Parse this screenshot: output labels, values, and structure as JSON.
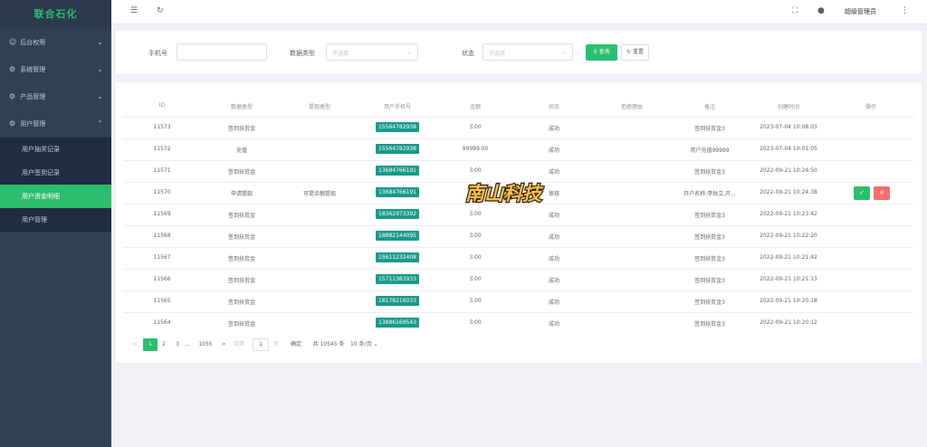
{
  "app": {
    "title": "联合石化"
  },
  "sidebar": {
    "items": [
      {
        "label": "后台权限",
        "icon": "user-icon"
      },
      {
        "label": "系统管理",
        "icon": "gear-icon"
      },
      {
        "label": "产品管理",
        "icon": "gear-icon"
      },
      {
        "label": "用户管理",
        "icon": "gear-icon"
      }
    ],
    "submenu": [
      {
        "label": "用户抽奖记录"
      },
      {
        "label": "用户签到记录"
      },
      {
        "label": "用户资金明细",
        "active": true
      },
      {
        "label": "用户管理"
      }
    ]
  },
  "topbar": {
    "user": "超级管理员"
  },
  "search": {
    "phone_label": "手机号",
    "type_label": "数据类型",
    "type_placeholder": "不选择",
    "status_label": "状态",
    "status_placeholder": "不选择",
    "search_button": "查询",
    "reset_button": "重置"
  },
  "table": {
    "headers": [
      "ID",
      "数据类型",
      "提现类型",
      "用户手机号",
      "金额",
      "状态",
      "拒绝理由",
      "备注",
      "创建时间",
      "操作"
    ],
    "rows": [
      {
        "id": "11573",
        "type": "签到扶贫金",
        "withdraw": "",
        "phone": "15564782938",
        "amount": "3.00",
        "status": "成功",
        "reason": "",
        "remark": "签到扶贫金3",
        "time": "2023-07-04 10:08:03"
      },
      {
        "id": "11572",
        "type": "充值",
        "withdraw": "",
        "phone": "15564782938",
        "amount": "99999.00",
        "status": "成功",
        "reason": "",
        "remark": "用户充值99999",
        "time": "2023-07-04 10:01:05"
      },
      {
        "id": "11571",
        "type": "签到扶贫金",
        "withdraw": "",
        "phone": "13684766191",
        "amount": "3.00",
        "status": "成功",
        "reason": "",
        "remark": "签到扶贫金3",
        "time": "2022-09-21 10:24:50"
      },
      {
        "id": "11570",
        "type": "申请提款",
        "withdraw": "可提余额提现",
        "phone": "13684766191",
        "amount": "",
        "status": "审核",
        "reason": "",
        "remark": "开户名称:李秋立,开...",
        "time": "2022-09-21 10:24:38",
        "actions": true
      },
      {
        "id": "11569",
        "type": "签到扶贫金",
        "withdraw": "",
        "phone": "18362973392",
        "amount": "3.00",
        "status": "成功",
        "reason": "",
        "remark": "签到扶贫金3",
        "time": "2022-09-21 10:23:42"
      },
      {
        "id": "11568",
        "type": "签到扶贫金",
        "withdraw": "",
        "phone": "18882144095",
        "amount": "3.00",
        "status": "成功",
        "reason": "",
        "remark": "签到扶贫金3",
        "time": "2022-09-21 10:22:20"
      },
      {
        "id": "11567",
        "type": "签到扶贫金",
        "withdraw": "",
        "phone": "15611232408",
        "amount": "3.00",
        "status": "成功",
        "reason": "",
        "remark": "签到扶贫金3",
        "time": "2022-09-21 10:21:42"
      },
      {
        "id": "11566",
        "type": "签到扶贫金",
        "withdraw": "",
        "phone": "15711383933",
        "amount": "3.00",
        "status": "成功",
        "reason": "",
        "remark": "签到扶贫金3",
        "time": "2022-09-21 10:21:13"
      },
      {
        "id": "11565",
        "type": "签到扶贫金",
        "withdraw": "",
        "phone": "18178216033",
        "amount": "3.00",
        "status": "成功",
        "reason": "",
        "remark": "签到扶贫金3",
        "time": "2022-09-21 10:20:18"
      },
      {
        "id": "11564",
        "type": "签到扶贫金",
        "withdraw": "",
        "phone": "13886169543",
        "amount": "3.00",
        "status": "成功",
        "reason": "",
        "remark": "签到扶贫金3",
        "time": "2022-09-21 10:20:12"
      }
    ]
  },
  "pagination": {
    "prev": "<",
    "pages": [
      "1",
      "2",
      "3",
      "...",
      "1055"
    ],
    "next": ">",
    "goto_label": "到第",
    "goto_value": "1",
    "page_unit": "页",
    "confirm": "确定",
    "total": "共 10545 条",
    "page_size": "10 条/页"
  },
  "watermark": {
    "text": "南山科技"
  },
  "colors": {
    "accent": "#2dbd6e",
    "sidebar": "#304156",
    "phone_tag": "#1a9a8a",
    "danger": "#f56c6c"
  }
}
